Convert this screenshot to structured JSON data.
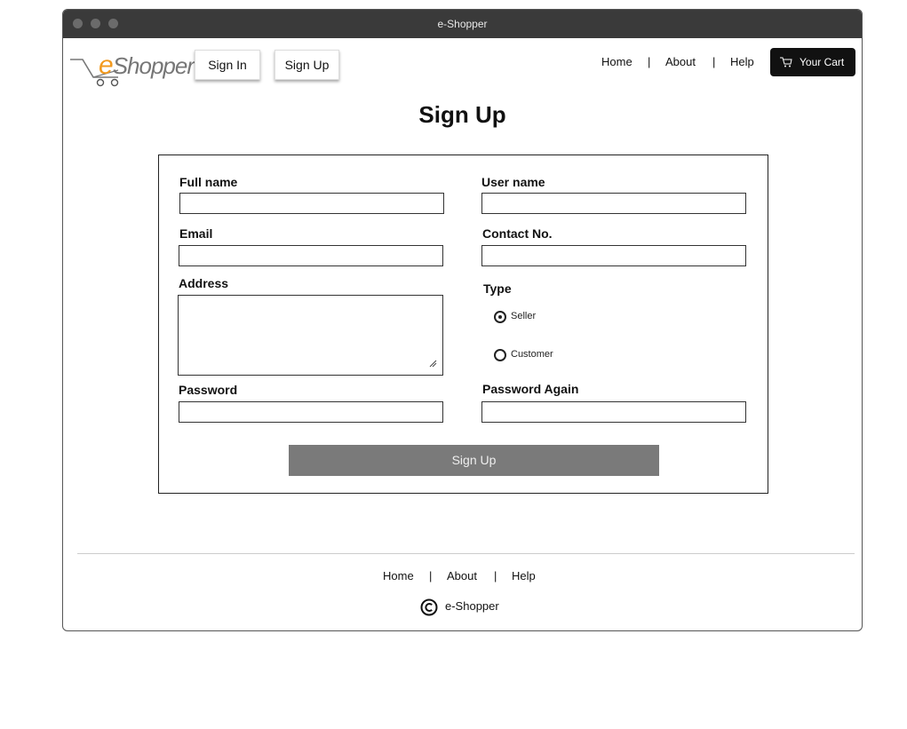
{
  "window": {
    "title": "e-Shopper"
  },
  "header": {
    "logo_text": "Shopper",
    "logo_e": "e",
    "signin_label": "Sign In",
    "signup_label": "Sign Up",
    "nav": {
      "home": "Home",
      "about": "About",
      "help": "Help",
      "sep": "|"
    },
    "cart_label": "Your Cart"
  },
  "page": {
    "title": "Sign Up"
  },
  "form": {
    "fullname": {
      "label": "Full name",
      "value": ""
    },
    "username": {
      "label": "User name",
      "value": ""
    },
    "email": {
      "label": "Email",
      "value": ""
    },
    "contact": {
      "label": "Contact No.",
      "value": ""
    },
    "address": {
      "label": "Address",
      "value": ""
    },
    "type": {
      "label": "Type",
      "options": [
        "Seller",
        "Customer"
      ],
      "selected": "Seller"
    },
    "password": {
      "label": "Password",
      "value": ""
    },
    "password_again": {
      "label": "Password Again",
      "value": ""
    },
    "submit_label": "Sign Up"
  },
  "footer": {
    "nav": {
      "home": "Home",
      "about": "About",
      "help": "Help",
      "sep": "|"
    },
    "copyright": "e-Shopper"
  },
  "colors": {
    "logo_accent": "#f29a1f",
    "titlebar": "#3a3a3a",
    "submit": "#7a7a7a"
  }
}
